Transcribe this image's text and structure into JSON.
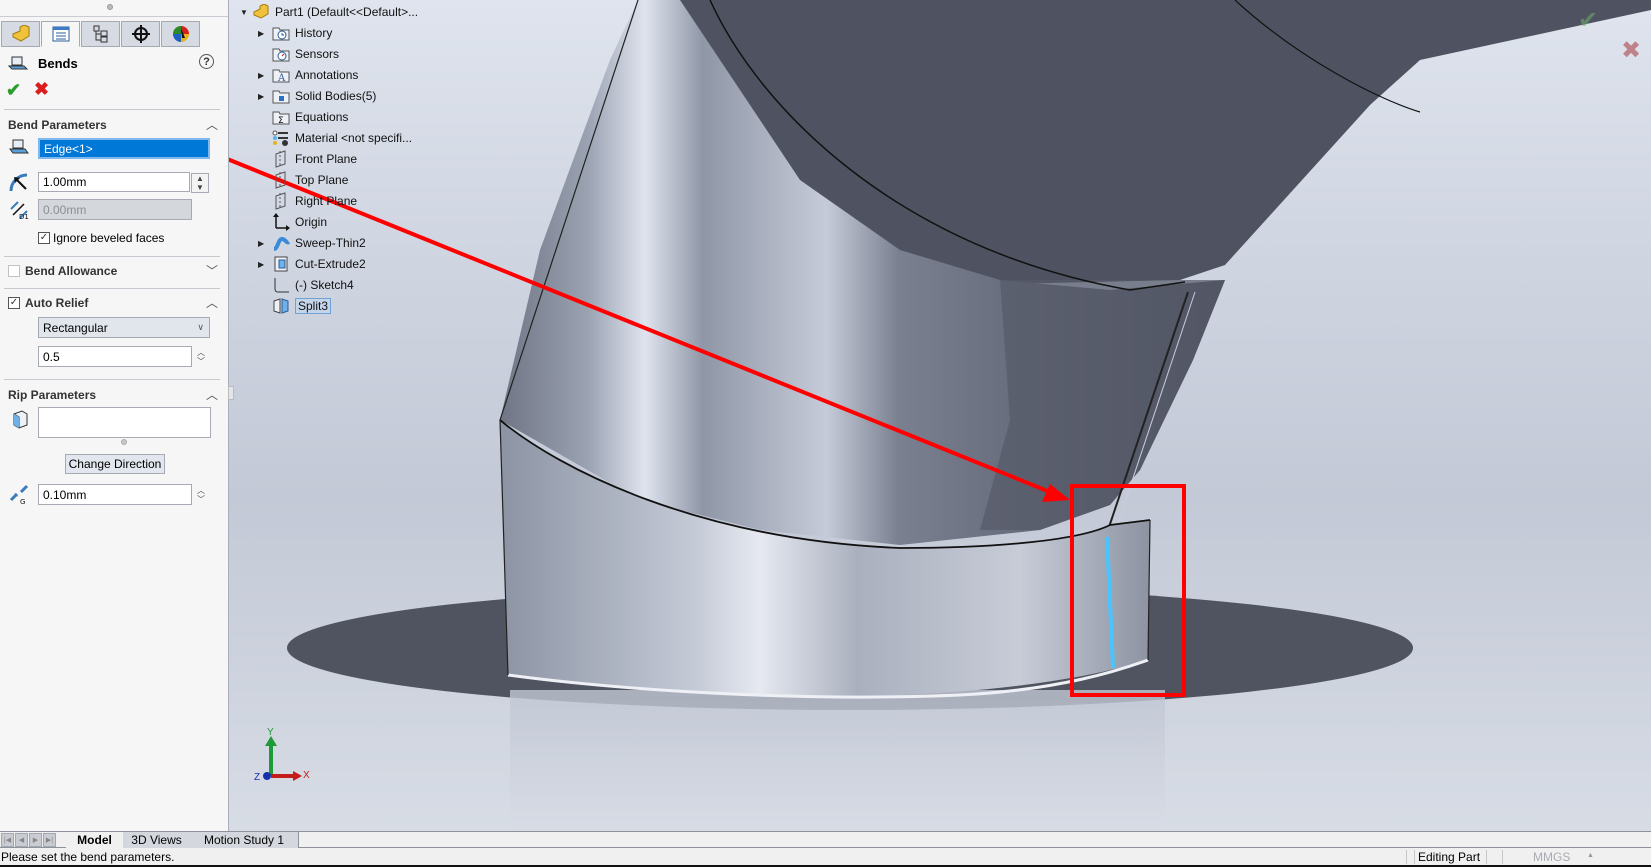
{
  "property_manager": {
    "tabs": [
      {
        "name": "feature-manager-tab",
        "icon": "part-icon"
      },
      {
        "name": "property-manager-tab",
        "icon": "property-list-icon",
        "active": true
      },
      {
        "name": "configuration-manager-tab",
        "icon": "configuration-tree-icon"
      },
      {
        "name": "dimxpert-manager-tab",
        "icon": "crosshair-icon"
      },
      {
        "name": "display-manager-tab",
        "icon": "appearance-ball-icon"
      }
    ],
    "title": "Bends",
    "help_label": "?",
    "ok_label": "✔",
    "cancel_label": "✖",
    "bend_parameters": {
      "header": "Bend Parameters",
      "edge_selection": "Edge<1>",
      "bend_radius": "1.00mm",
      "thickness": "0.00mm",
      "ignore_beveled_faces_label": "Ignore beveled faces",
      "ignore_beveled_faces_checked": true
    },
    "bend_allowance": {
      "header": "Bend Allowance",
      "checked": false
    },
    "auto_relief": {
      "header": "Auto Relief",
      "checked": true,
      "type_selected": "Rectangular",
      "ratio": "0.5"
    },
    "rip_parameters": {
      "header": "Rip Parameters",
      "edges_selection": "",
      "change_direction_label": "Change Direction",
      "rip_gap": "0.10mm"
    }
  },
  "feature_tree": {
    "root": "Part1  (Default<<Default>...",
    "items": [
      {
        "label": "History",
        "icon": "history-folder-icon",
        "expandable": true
      },
      {
        "label": "Sensors",
        "icon": "sensors-folder-icon",
        "expandable": false
      },
      {
        "label": "Annotations",
        "icon": "annotations-folder-icon",
        "expandable": true
      },
      {
        "label": "Solid Bodies(5)",
        "icon": "solid-bodies-folder-icon",
        "expandable": true
      },
      {
        "label": "Equations",
        "icon": "equations-folder-icon",
        "expandable": false
      },
      {
        "label": "Material <not specifi...",
        "icon": "material-icon",
        "expandable": false
      },
      {
        "label": "Front Plane",
        "icon": "plane-icon",
        "expandable": false
      },
      {
        "label": "Top Plane",
        "icon": "plane-icon",
        "expandable": false
      },
      {
        "label": "Right Plane",
        "icon": "plane-icon",
        "expandable": false
      },
      {
        "label": "Origin",
        "icon": "origin-icon",
        "expandable": false
      },
      {
        "label": "Sweep-Thin2",
        "icon": "sweep-icon",
        "expandable": true
      },
      {
        "label": "Cut-Extrude2",
        "icon": "cut-extrude-icon",
        "expandable": true
      },
      {
        "label": "(-) Sketch4",
        "icon": "sketch-icon",
        "expandable": false
      },
      {
        "label": "Split3",
        "icon": "split-icon",
        "expandable": false,
        "selected": true
      }
    ]
  },
  "viewport": {
    "triad": {
      "x": "X",
      "y": "Y",
      "z": "Z"
    },
    "confirm_ok": "✔",
    "confirm_cancel": "✖",
    "annotation_color": "#ff0000",
    "highlight_edge_color": "#49c4ff"
  },
  "bottom_tabs": [
    {
      "label": "Model",
      "active": true
    },
    {
      "label": "3D Views",
      "active": false
    },
    {
      "label": "Motion Study 1",
      "active": false
    }
  ],
  "status_bar": {
    "message": "Please set the bend parameters.",
    "mode": "Editing Part",
    "units": "MMGS",
    "units_arrow": "▲"
  }
}
